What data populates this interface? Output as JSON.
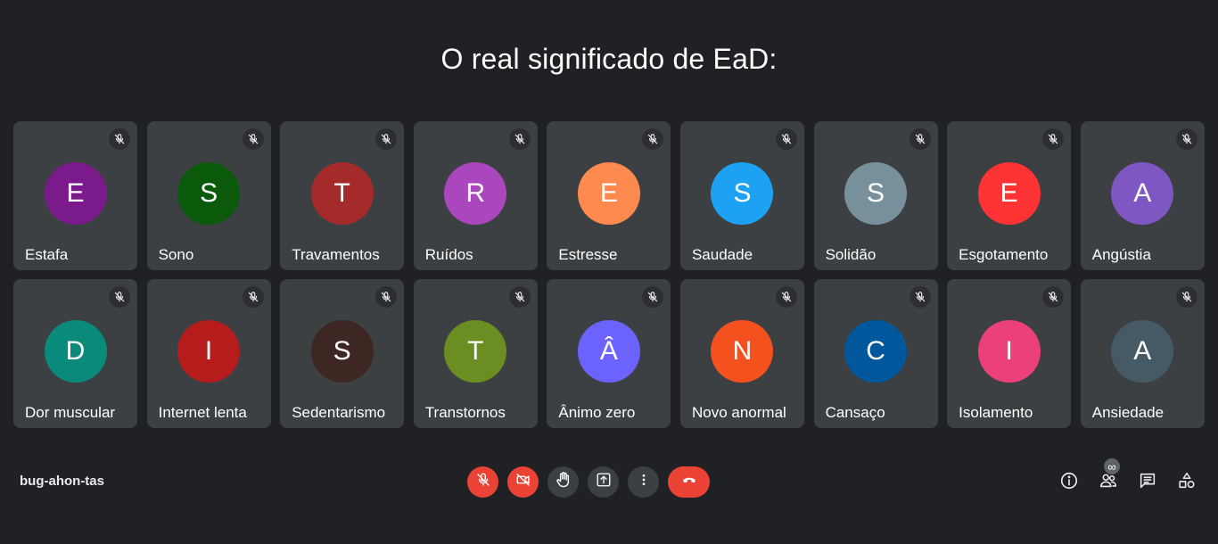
{
  "title": "O real significado de EaD:",
  "meeting_code": "bug-ahon-tas",
  "participants_count": "∞",
  "participants": [
    {
      "initial": "E",
      "name": "Estafa",
      "color": "#7b1a8a"
    },
    {
      "initial": "S",
      "name": "Sono",
      "color": "#0b5a0b"
    },
    {
      "initial": "T",
      "name": "Travamentos",
      "color": "#a52a2a"
    },
    {
      "initial": "R",
      "name": "Ruídos",
      "color": "#ab47bc"
    },
    {
      "initial": "E",
      "name": "Estresse",
      "color": "#ff8a50"
    },
    {
      "initial": "S",
      "name": "Saudade",
      "color": "#1da1f2"
    },
    {
      "initial": "S",
      "name": "Solidão",
      "color": "#78909c"
    },
    {
      "initial": "E",
      "name": "Esgotamento",
      "color": "#ff3333"
    },
    {
      "initial": "A",
      "name": "Angústia",
      "color": "#7e57c2"
    },
    {
      "initial": "D",
      "name": "Dor muscular",
      "color": "#0a8a7a"
    },
    {
      "initial": "I",
      "name": "Internet lenta",
      "color": "#b71c1c"
    },
    {
      "initial": "S",
      "name": "Sedentarismo",
      "color": "#3e2723"
    },
    {
      "initial": "T",
      "name": "Transtornos",
      "color": "#6b8e23"
    },
    {
      "initial": "Â",
      "name": "Ânimo zero",
      "color": "#6c63ff"
    },
    {
      "initial": "N",
      "name": "Novo anormal",
      "color": "#f4511e"
    },
    {
      "initial": "C",
      "name": "Cansaço",
      "color": "#01579b"
    },
    {
      "initial": "I",
      "name": "Isolamento",
      "color": "#ec407a"
    },
    {
      "initial": "A",
      "name": "Ansiedade",
      "color": "#455a64"
    }
  ],
  "icons": {
    "tile_mute": "mic-off-icon",
    "controls": [
      "mic-off-icon",
      "camera-off-icon",
      "raise-hand-icon",
      "present-icon",
      "more-options-icon",
      "hang-up-icon"
    ],
    "right": [
      "info-icon",
      "people-icon",
      "chat-icon",
      "activities-icon"
    ]
  },
  "colors": {
    "background": "#202124",
    "tile": "#3c4043",
    "danger": "#ea4335"
  }
}
